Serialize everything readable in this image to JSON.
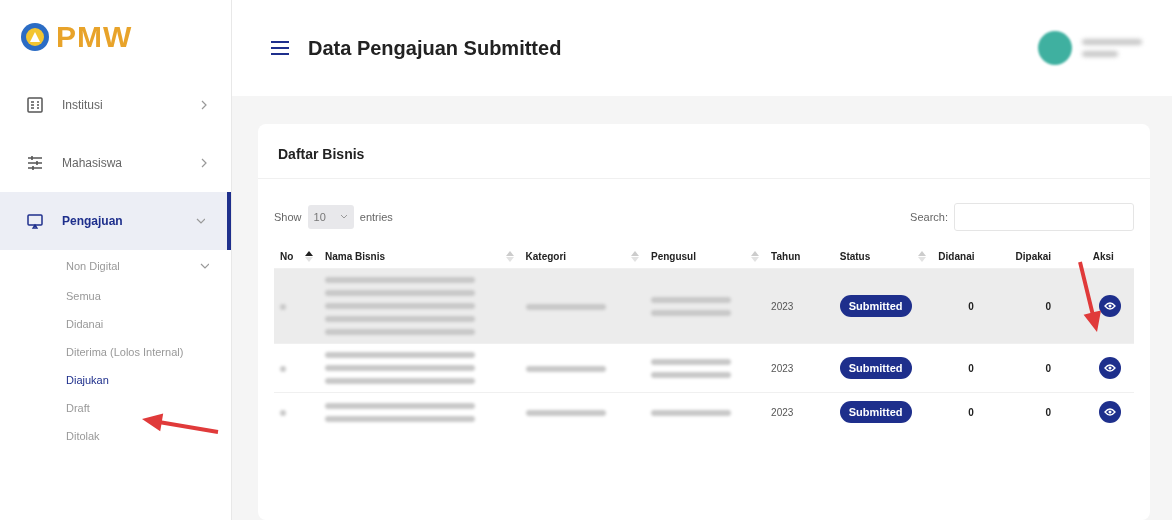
{
  "logo": {
    "text": "PMW"
  },
  "sidebar": {
    "items": [
      {
        "label": "Institusi",
        "expanded": false,
        "selected": false
      },
      {
        "label": "Mahasiswa",
        "expanded": false,
        "selected": false
      },
      {
        "label": "Pengajuan",
        "expanded": true,
        "selected": true,
        "children": [
          {
            "label": "Non Digital",
            "expanded": true,
            "selected": false,
            "children": [
              {
                "label": "Semua",
                "selected": false
              },
              {
                "label": "Didanai",
                "selected": false
              },
              {
                "label": "Diterima (Lolos Internal)",
                "selected": false
              },
              {
                "label": "Diajukan",
                "selected": true
              },
              {
                "label": "Draft",
                "selected": false
              },
              {
                "label": "Ditolak",
                "selected": false
              }
            ]
          }
        ]
      }
    ]
  },
  "header": {
    "title": "Data Pengajuan Submitted",
    "user": {
      "redacted": true
    }
  },
  "card": {
    "title": "Daftar Bisnis",
    "length_menu": {
      "before": "Show",
      "value": "10",
      "after": "entries"
    },
    "search": {
      "label": "Search:"
    },
    "table": {
      "columns": [
        {
          "label": "No",
          "sortable": true,
          "sorted": true
        },
        {
          "label": "Nama Bisnis",
          "sortable": true,
          "sorted": false
        },
        {
          "label": "Kategori",
          "sortable": true,
          "sorted": false
        },
        {
          "label": "Pengusul",
          "sortable": true,
          "sorted": false
        },
        {
          "label": "Tahun",
          "sortable": false,
          "sorted": false
        },
        {
          "label": "Status",
          "sortable": true,
          "sorted": false
        },
        {
          "label": "Didanai",
          "sortable": false,
          "sorted": false
        },
        {
          "label": "Dipakai",
          "sortable": false,
          "sorted": false
        },
        {
          "label": "Aksi",
          "sortable": false,
          "sorted": false
        }
      ],
      "rows": [
        {
          "redacted": true,
          "tahun": "2023",
          "status": "Submitted",
          "didanai": "0",
          "dipakai": "0",
          "striped": true
        },
        {
          "redacted": true,
          "tahun": "2023",
          "status": "Submitted",
          "didanai": "0",
          "dipakai": "0",
          "striped": false
        },
        {
          "redacted": true,
          "tahun": "2023",
          "status": "Submitted",
          "didanai": "0",
          "dipakai": "0",
          "striped": false
        }
      ]
    }
  },
  "annotations": [
    {
      "kind": "arrow"
    },
    {
      "kind": "arrow"
    }
  ]
}
